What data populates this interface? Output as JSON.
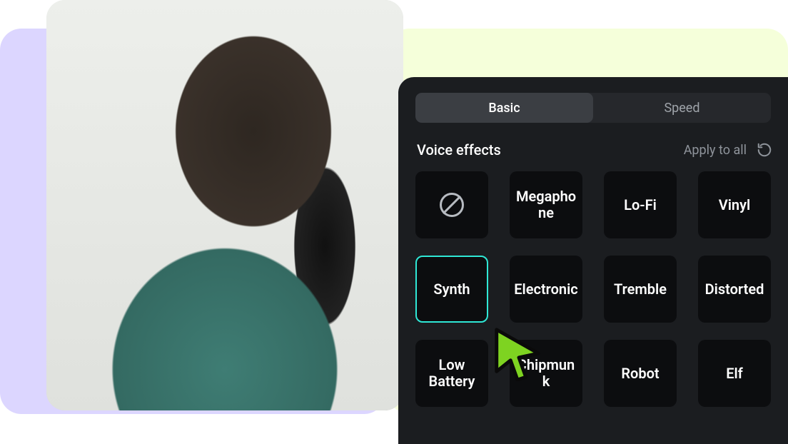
{
  "tabs": {
    "basic": "Basic",
    "speed": "Speed"
  },
  "section": {
    "title": "Voice effects",
    "apply_label": "Apply to all"
  },
  "effects": [
    {
      "id": "none",
      "label": "",
      "icon": true
    },
    {
      "id": "megaphone",
      "label": "Megaphone"
    },
    {
      "id": "lofi",
      "label": "Lo-Fi"
    },
    {
      "id": "vinyl",
      "label": "Vinyl"
    },
    {
      "id": "synth",
      "label": "Synth",
      "selected": true
    },
    {
      "id": "electronic",
      "label": "Electronic"
    },
    {
      "id": "tremble",
      "label": "Tremble"
    },
    {
      "id": "distorted",
      "label": "Distorted"
    },
    {
      "id": "lowbattery",
      "label": "Low Battery"
    },
    {
      "id": "chipmunk",
      "label": "Chipmunk"
    },
    {
      "id": "robot",
      "label": "Robot"
    },
    {
      "id": "elf",
      "label": "Elf"
    }
  ],
  "colors": {
    "accent": "#2fe8d6",
    "cursor": "#7ed321"
  }
}
